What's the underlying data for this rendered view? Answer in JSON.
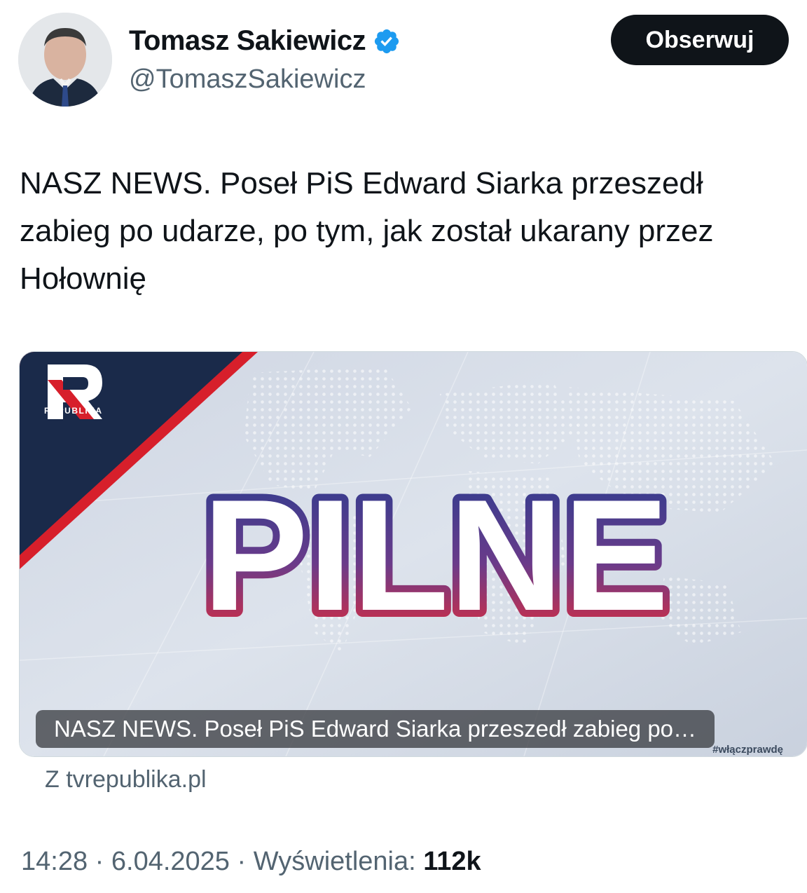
{
  "author": {
    "name": "Tomasz Sakiewicz",
    "handle": "@TomaszSakiewicz",
    "verified_icon": "verified-badge-icon",
    "verified_color": "#1d9bf0"
  },
  "follow_button": {
    "label": "Obserwuj"
  },
  "tweet": {
    "text": "NASZ NEWS. Poseł PiS Edward Siarka przeszedł zabieg po udarze, po tym, jak został ukarany przez Hołownię"
  },
  "card": {
    "image": {
      "logo_text": "REPUBLIKA",
      "headline": "PILNE",
      "hashtag": "#włączprawdę"
    },
    "caption": "NASZ NEWS. Poseł PiS Edward Siarka przeszedł zabieg po…",
    "source": "Z tvrepublika.pl"
  },
  "meta": {
    "time": "14:28",
    "separator": "·",
    "date": "6.04.2025",
    "views_label": "Wyświetlenia:",
    "views_count": "112k"
  },
  "colors": {
    "text_primary": "#0f1419",
    "text_secondary": "#536471",
    "button_bg": "#0f1419",
    "brand_red": "#d71f2b",
    "brand_navy": "#1a2a4a"
  }
}
